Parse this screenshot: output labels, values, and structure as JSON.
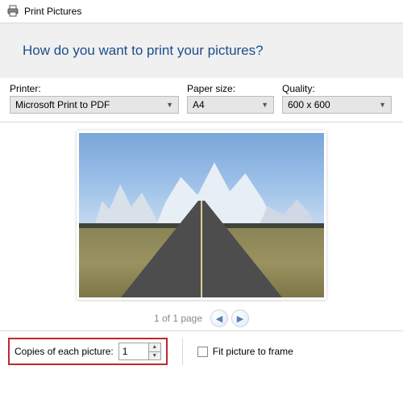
{
  "window": {
    "title": "Print Pictures"
  },
  "heading": "How do you want to print your pictures?",
  "fields": {
    "printer": {
      "label": "Printer:",
      "value": "Microsoft Print to PDF"
    },
    "paperSize": {
      "label": "Paper size:",
      "value": "A4"
    },
    "quality": {
      "label": "Quality:",
      "value": "600 x 600"
    }
  },
  "pager": {
    "text": "1 of 1 page"
  },
  "copies": {
    "label": "Copies of each picture:",
    "value": "1"
  },
  "fit": {
    "label": "Fit picture to frame",
    "checked": false
  }
}
